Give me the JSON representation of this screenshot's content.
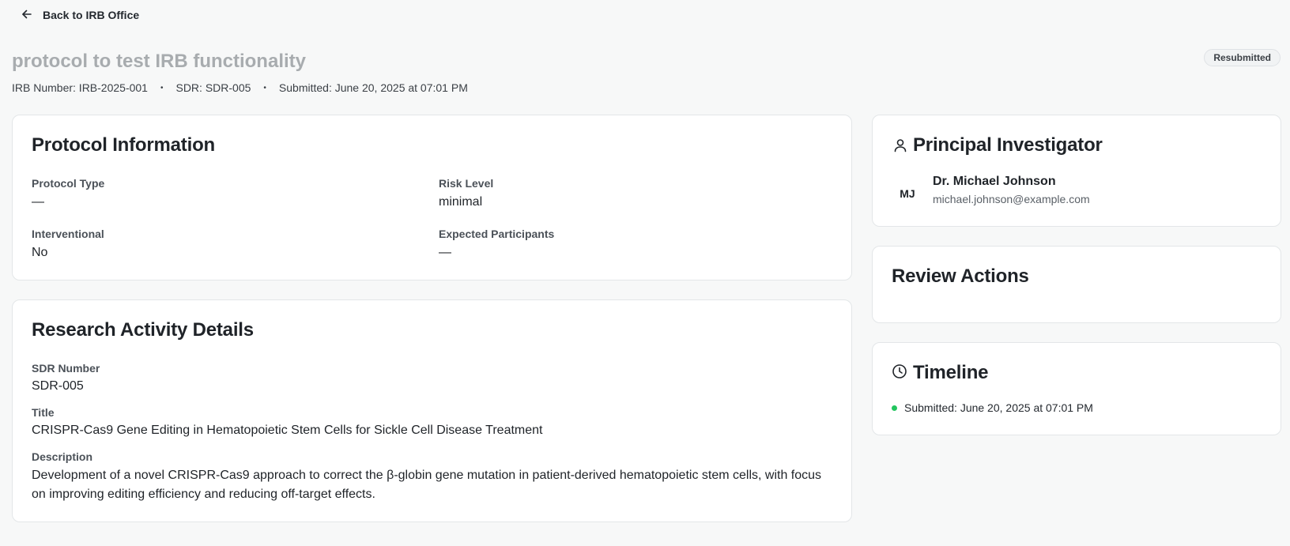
{
  "nav": {
    "back_label": "Back to IRB Office"
  },
  "header": {
    "title": "protocol to test IRB functionality",
    "status_badge": "Resubmitted",
    "irb_number": "IRB Number: IRB-2025-001",
    "sdr": "SDR: SDR-005",
    "submitted": "Submitted: June 20, 2025 at 07:01 PM",
    "separator": "•"
  },
  "protocol_info": {
    "title": "Protocol Information",
    "protocol_type_label": "Protocol Type",
    "protocol_type_value": "—",
    "risk_level_label": "Risk Level",
    "risk_level_value": "minimal",
    "interventional_label": "Interventional",
    "interventional_value": "No",
    "expected_participants_label": "Expected Participants",
    "expected_participants_value": "—"
  },
  "research_activity": {
    "title": "Research Activity Details",
    "sdr_number_label": "SDR Number",
    "sdr_number_value": "SDR-005",
    "title_label": "Title",
    "title_value": "CRISPR-Cas9 Gene Editing in Hematopoietic Stem Cells for Sickle Cell Disease Treatment",
    "description_label": "Description",
    "description_value": "Development of a novel CRISPR-Cas9 approach to correct the β-globin gene mutation in patient-derived hematopoietic stem cells, with focus on improving editing efficiency and reducing off-target effects."
  },
  "principal_investigator": {
    "title": "Principal Investigator",
    "icon": "user-icon",
    "initials": "MJ",
    "name": "Dr. Michael Johnson",
    "email": "michael.johnson@example.com"
  },
  "review_actions": {
    "title": "Review Actions"
  },
  "timeline": {
    "title": "Timeline",
    "icon": "clock-icon",
    "items": [
      {
        "label": "Submitted: June 20, 2025 at 07:01 PM",
        "dot_color": "#22c55e"
      }
    ]
  }
}
